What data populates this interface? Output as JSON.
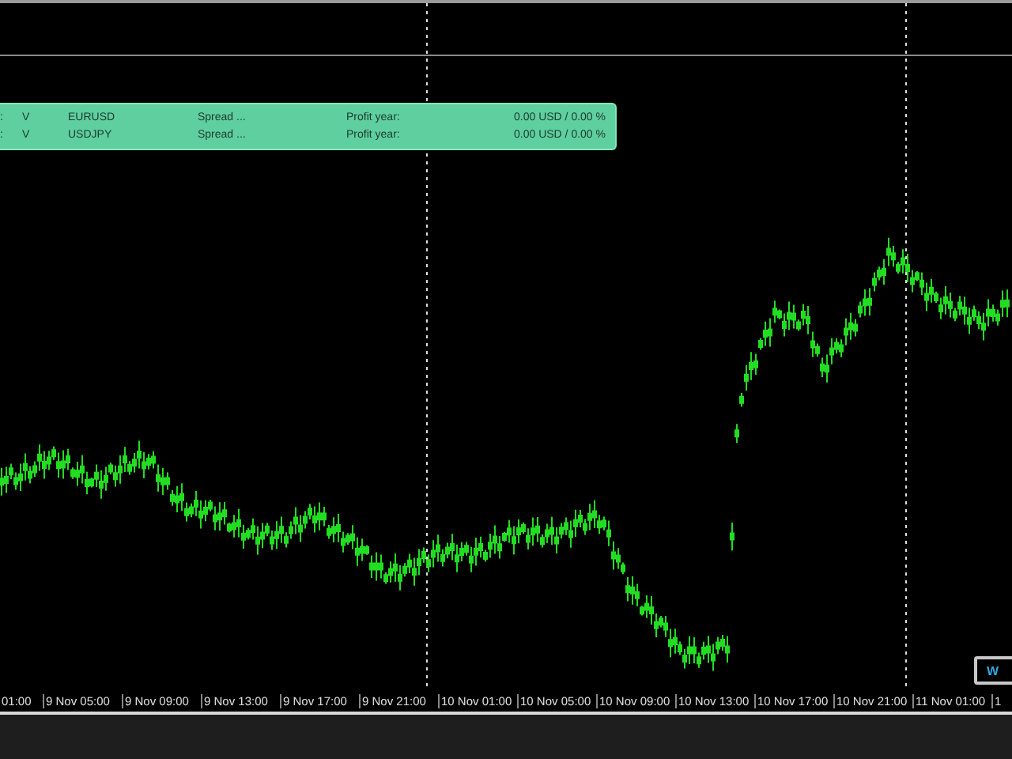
{
  "info_panel": {
    "rows": [
      {
        "index": ":",
        "mark": "V",
        "symbol": "EURUSD",
        "spread": "Spread ...",
        "profit_label": "Profit year:",
        "profit_value": "0.00 USD / 0.00 %"
      },
      {
        "index": ":",
        "mark": "V",
        "symbol": "USDJPY",
        "spread": "Spread ...",
        "profit_label": "Profit year:",
        "profit_value": "0.00 USD / 0.00 %"
      }
    ]
  },
  "corner_button": {
    "label": "W"
  },
  "time_axis": [
    "01:00",
    "9 Nov 05:00",
    "9 Nov 09:00",
    "9 Nov 13:00",
    "9 Nov 17:00",
    "9 Nov 21:00",
    "10 Nov 01:00",
    "10 Nov 05:00",
    "10 Nov 09:00",
    "10 Nov 13:00",
    "10 Nov 17:00",
    "10 Nov 21:00",
    "11 Nov 01:00",
    "1"
  ]
}
